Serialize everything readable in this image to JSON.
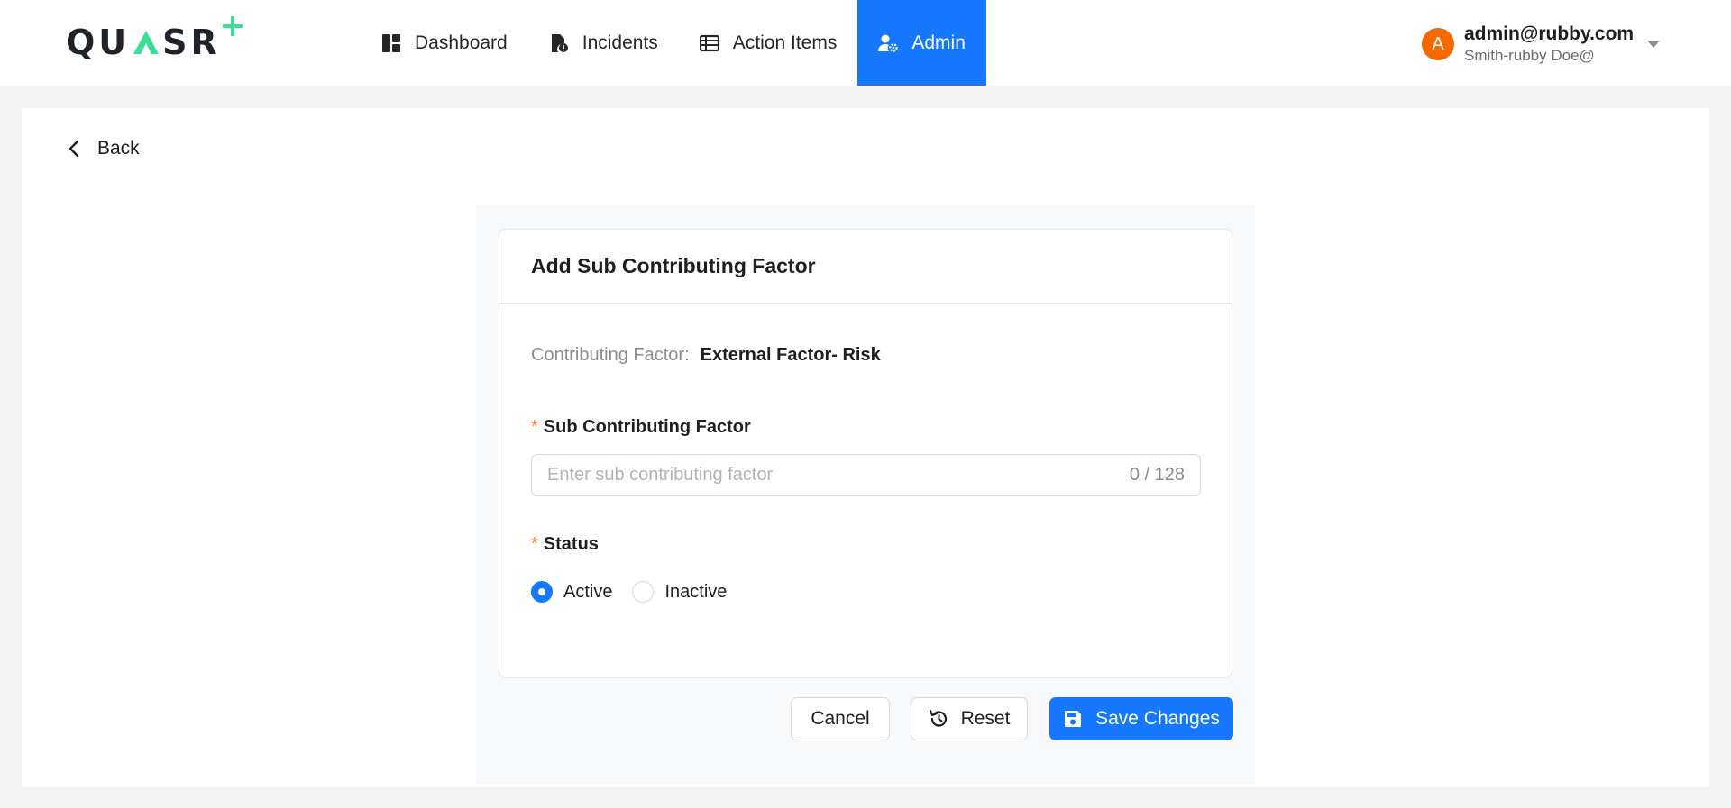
{
  "header": {
    "logo_text": "QUASR",
    "nav": [
      {
        "label": "Dashboard",
        "icon": "dashboard-icon"
      },
      {
        "label": "Incidents",
        "icon": "incident-file-icon"
      },
      {
        "label": "Action Items",
        "icon": "table-list-icon"
      },
      {
        "label": "Admin",
        "icon": "user-gear-icon",
        "active": true
      }
    ],
    "user": {
      "avatar_initial": "A",
      "email": "admin@rubby.com",
      "name": "Smith-rubby Doe@"
    }
  },
  "back": {
    "label": "Back"
  },
  "form": {
    "title": "Add Sub Contributing Factor",
    "contributing_factor_label": "Contributing Factor:",
    "contributing_factor_value": "External Factor- Risk",
    "required_mark": "*",
    "sub_factor_label": "Sub Contributing Factor",
    "sub_factor_placeholder": "Enter sub contributing factor",
    "sub_factor_value": "",
    "sub_factor_counter": "0 / 128",
    "status_label": "Status",
    "status_options": [
      {
        "label": "Active",
        "checked": true
      },
      {
        "label": "Inactive",
        "checked": false
      }
    ]
  },
  "actions": {
    "cancel": "Cancel",
    "reset": "Reset",
    "save": "Save Changes"
  },
  "colors": {
    "primary": "#1677ff",
    "avatar": "#f56a00",
    "required": "#ff7a45",
    "logo_accent": "#3ddc97"
  }
}
